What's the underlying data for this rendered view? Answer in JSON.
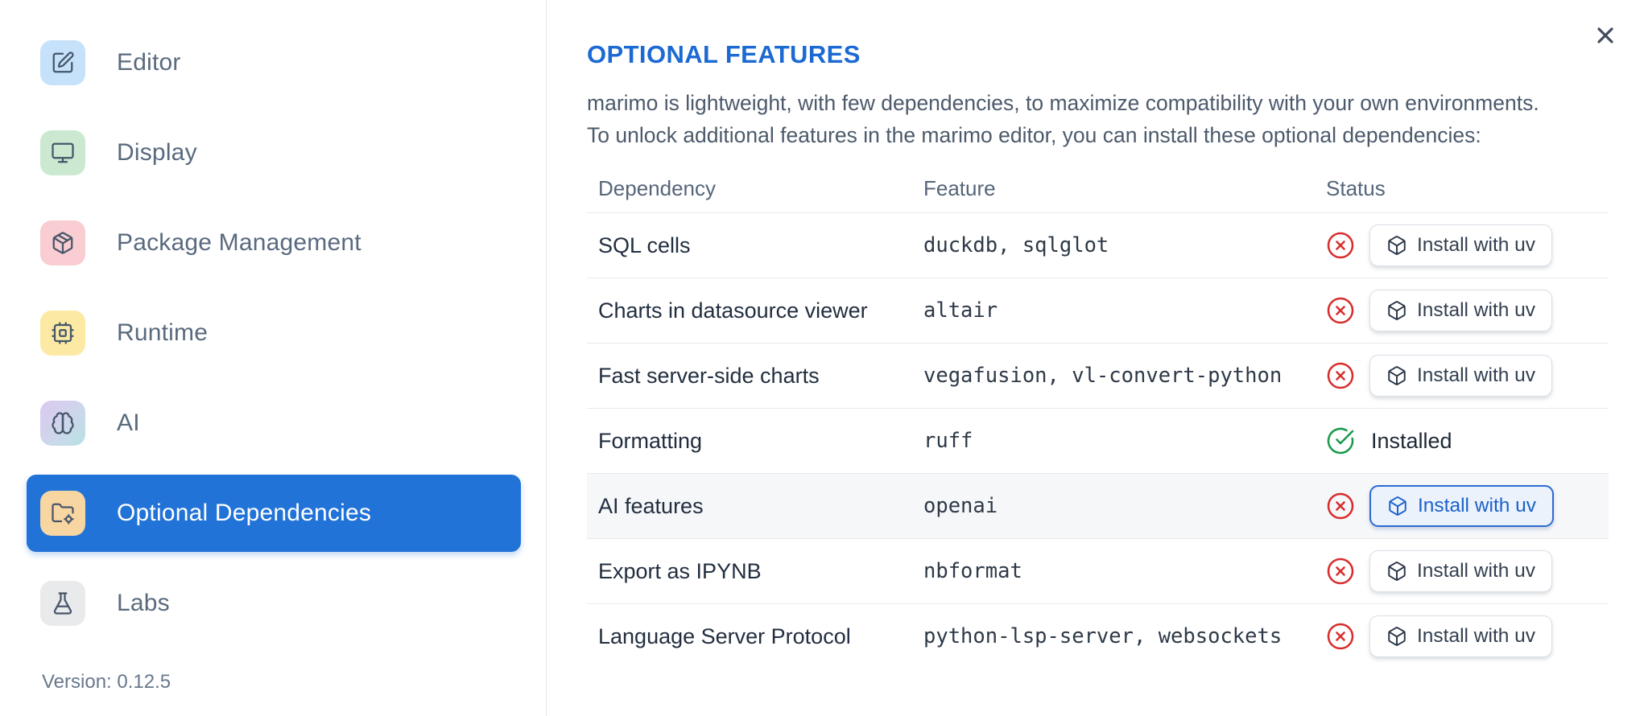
{
  "sidebar": {
    "items": [
      {
        "label": "Editor",
        "icon": "square-pen-icon",
        "icon_bg": "#c5e2fa",
        "selected": false
      },
      {
        "label": "Display",
        "icon": "monitor-icon",
        "icon_bg": "#cbe9d0",
        "selected": false
      },
      {
        "label": "Package Management",
        "icon": "package-icon",
        "icon_bg": "#f9cdd1",
        "selected": false
      },
      {
        "label": "Runtime",
        "icon": "cpu-icon",
        "icon_bg": "#fbe9a4",
        "selected": false
      },
      {
        "label": "AI",
        "icon": "brain-icon",
        "icon_bg": "linear-gradient(135deg,#dcc8f0,#b7e2e4)",
        "selected": false
      },
      {
        "label": "Optional Dependencies",
        "icon": "folder-cog-icon",
        "icon_bg": "#f8d6a2",
        "selected": true
      },
      {
        "label": "Labs",
        "icon": "flask-icon",
        "icon_bg": "#e9eaec",
        "selected": false
      }
    ],
    "version": "Version: 0.12.5"
  },
  "header": {
    "title": "OPTIONAL FEATURES"
  },
  "intro": {
    "line1": "marimo is lightweight, with few dependencies, to maximize compatibility with your own environments.",
    "line2": "To unlock additional features in the marimo editor, you can install these optional dependencies:"
  },
  "table": {
    "headers": {
      "dependency": "Dependency",
      "feature": "Feature",
      "status": "Status"
    },
    "rows": [
      {
        "dependency": "SQL cells",
        "feature": "duckdb, sqlglot",
        "installed": false,
        "action": "Install with uv",
        "highlighted": false
      },
      {
        "dependency": "Charts in datasource viewer",
        "feature": "altair",
        "installed": false,
        "action": "Install with uv",
        "highlighted": false
      },
      {
        "dependency": "Fast server-side charts",
        "feature": "vegafusion, vl-convert-python",
        "installed": false,
        "action": "Install with uv",
        "highlighted": false
      },
      {
        "dependency": "Formatting",
        "feature": "ruff",
        "installed": true,
        "status_text": "Installed",
        "highlighted": false
      },
      {
        "dependency": "AI features",
        "feature": "openai",
        "installed": false,
        "action": "Install with uv",
        "highlighted": true
      },
      {
        "dependency": "Export as IPYNB",
        "feature": "nbformat",
        "installed": false,
        "action": "Install with uv",
        "highlighted": false
      },
      {
        "dependency": "Language Server Protocol",
        "feature": "python-lsp-server, websockets",
        "installed": false,
        "action": "Install with uv",
        "highlighted": false
      }
    ]
  },
  "colors": {
    "accent_blue": "#2173d8",
    "title_blue": "#1b69d3",
    "error_red": "#d92d2d",
    "success_green": "#189a4a",
    "highlight_row_bg": "#f6f7f9",
    "highlight_button_bg": "#ebf2fc",
    "highlight_button_border": "#2b6bd2",
    "sidebar_border": "#e4e7ec"
  }
}
